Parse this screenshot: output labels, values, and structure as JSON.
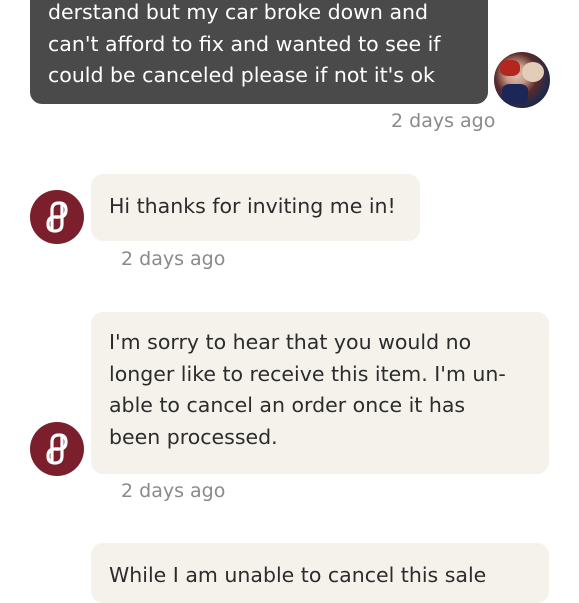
{
  "messages": [
    {
      "sender": "user",
      "lines": [
        "derstand but my car broke down and",
        "can't afford to fix and wanted to see if",
        "could be canceled please if not it's ok"
      ],
      "time": "2 days ago"
    },
    {
      "sender": "agent",
      "lines": [
        "Hi thanks for inviting me in!"
      ],
      "time": "2 days ago"
    },
    {
      "sender": "agent",
      "lines": [
        "I'm sorry to hear that you would no",
        "longer like to receive this item. I'm un-",
        "able to cancel an order once it has",
        "been processed."
      ],
      "time": "2 days ago"
    },
    {
      "sender": "agent",
      "lines": [
        "While I am unable to cancel this sale"
      ]
    }
  ],
  "colors": {
    "user_bubble": "#4a4a4a",
    "agent_bubble": "#f5f2ec",
    "brand": "#7a1f2b"
  }
}
